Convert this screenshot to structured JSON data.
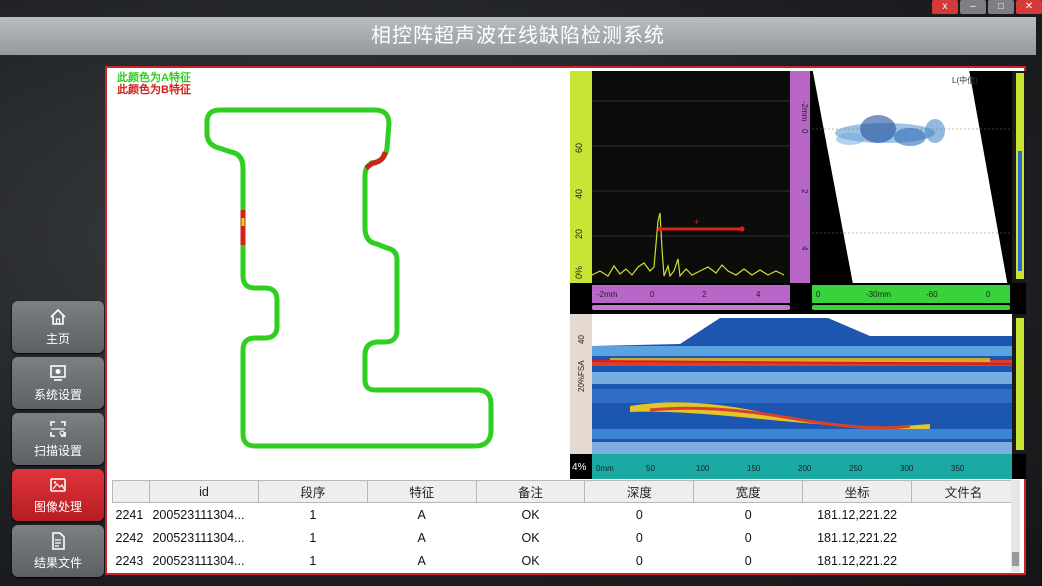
{
  "window": {
    "title": "相控阵超声波在线缺陷检测系统",
    "controls": [
      "x",
      "–",
      "□",
      "✕"
    ]
  },
  "nav": [
    {
      "label": "主页",
      "icon": "home-icon"
    },
    {
      "label": "系统设置",
      "icon": "settings-icon"
    },
    {
      "label": "扫描设置",
      "icon": "scan-icon"
    },
    {
      "label": "图像处理",
      "icon": "image-icon",
      "active": true
    },
    {
      "label": "结果文件",
      "icon": "file-icon"
    }
  ],
  "legend": {
    "a": "此颜色为A特征",
    "b": "此颜色为B特征"
  },
  "colors": {
    "feature_a": "#2fcf20",
    "feature_b": "#d0221c",
    "accent": "#c8242b",
    "active_nav": "#d42b31"
  },
  "ascan": {
    "scale_left": [
      "60",
      "40",
      "20",
      "0%"
    ],
    "scale_bottom": [
      "-2mm",
      "0",
      "2",
      "4"
    ]
  },
  "sscan": {
    "header": "L(中值)",
    "scale_left": [
      "-2mm",
      "0",
      "2",
      "4"
    ],
    "scale_bottom": [
      "0",
      "-30mm",
      "-60",
      "0"
    ]
  },
  "cscan": {
    "scale_left": [
      "40",
      "20%FSA"
    ],
    "corner": "4%",
    "scale_bottom": [
      "0mm",
      "50",
      "100",
      "150",
      "200",
      "250",
      "300",
      "350"
    ]
  },
  "table": {
    "columns": [
      "",
      "id",
      "段序",
      "特征",
      "备注",
      "深度",
      "宽度",
      "坐标",
      "文件名"
    ],
    "rows": [
      [
        "2241",
        "200523111304...",
        "1",
        "A",
        "OK",
        "0",
        "0",
        "181.12,221.22",
        ""
      ],
      [
        "2242",
        "200523111304...",
        "1",
        "A",
        "OK",
        "0",
        "0",
        "181.12,221.22",
        ""
      ],
      [
        "2243",
        "200523111304...",
        "1",
        "A",
        "OK",
        "0",
        "0",
        "181.12,221.22",
        ""
      ]
    ]
  }
}
